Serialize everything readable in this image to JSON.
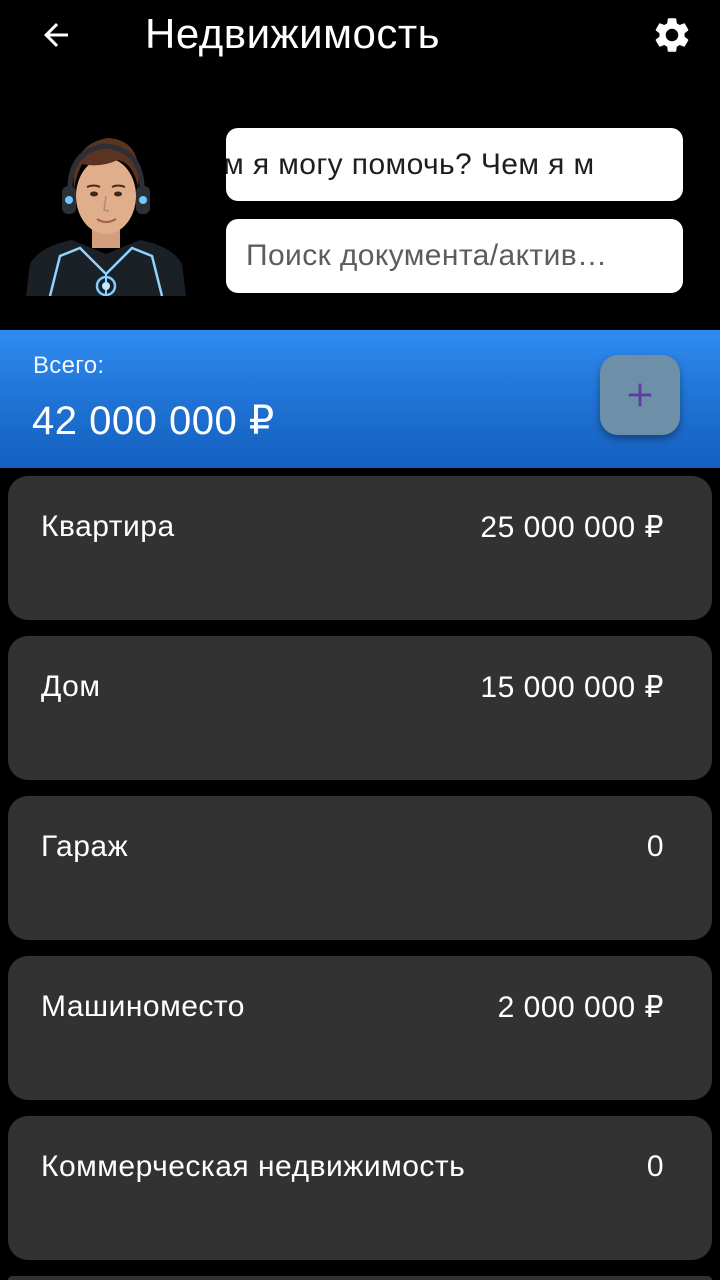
{
  "header": {
    "title": "Недвижимость",
    "back_icon": "arrow-back-icon",
    "settings_icon": "gear-icon"
  },
  "assistant": {
    "avatar_icon": "assistant-avatar",
    "marquee_text": "ем я могу помочь?     Чем я м",
    "search_placeholder": "Поиск документа/актив…"
  },
  "summary": {
    "label": "Всего:",
    "value": "42 000 000 ₽",
    "add_icon": "plus-icon"
  },
  "items": [
    {
      "name": "Квартира",
      "value": "25 000 000 ₽"
    },
    {
      "name": "Дом",
      "value": "15 000 000 ₽"
    },
    {
      "name": "Гараж",
      "value": "0"
    },
    {
      "name": "Машиноместо",
      "value": "2 000 000 ₽"
    },
    {
      "name": "Коммерческая недвижимость",
      "value": "0"
    }
  ],
  "colors": {
    "background": "#000000",
    "card": "#323232",
    "accent_blue": "#2f8cef",
    "add_button": "#6e8fa8",
    "add_icon": "#5b3d9e"
  }
}
